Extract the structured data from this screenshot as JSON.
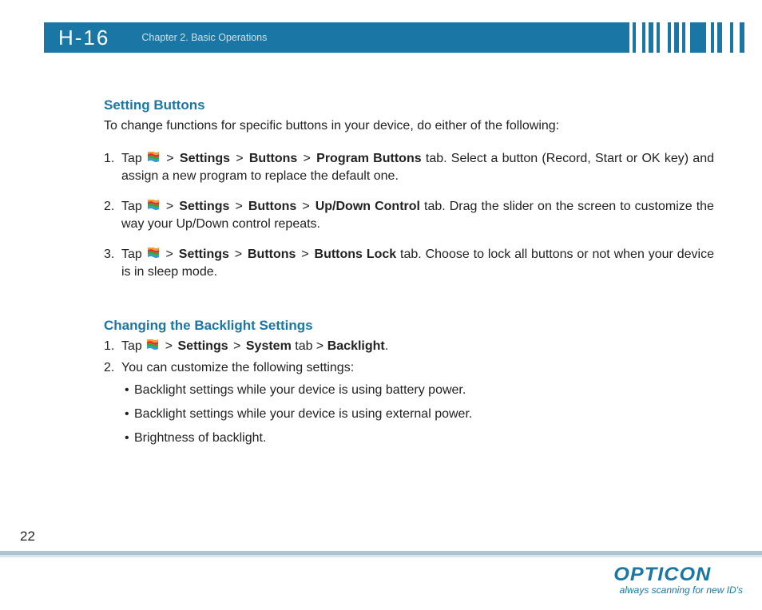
{
  "header": {
    "model": "H-16",
    "chapter": "Chapter 2. Basic Operations"
  },
  "sections": {
    "s1": {
      "heading": "Setting Buttons",
      "intro": "To change functions for specific buttons in your device, do either of the following:",
      "items": [
        {
          "num": "1.",
          "pre": "Tap ",
          "path1": "Settings",
          "path2": "Buttons",
          "path3": "Program Buttons",
          "post": " tab. Select a button (Record, Start or OK key) and assign a new program to replace the default one."
        },
        {
          "num": "2.",
          "pre": "Tap ",
          "path1": "Settings",
          "path2": "Buttons",
          "path3": "Up/Down Control",
          "post": " tab. Drag the slider on the screen to customize the way your Up/Down control repeats."
        },
        {
          "num": "3.",
          "pre": "Tap ",
          "path1": "Settings",
          "path2": "Buttons",
          "path3": "Buttons Lock",
          "post": " tab. Choose to lock all buttons or not when your device is in sleep mode."
        }
      ]
    },
    "s2": {
      "heading": "Changing the Backlight Settings",
      "items": [
        {
          "num": "1.",
          "pre": "Tap ",
          "path1": "Settings",
          "path2": "System",
          "tabword": " tab > ",
          "path3": "Backlight",
          "post": "."
        },
        {
          "num": "2.",
          "text": "You can customize the following settings:"
        }
      ],
      "bullets": [
        "Backlight settings while your device is using battery power.",
        "Backlight settings while your device is using external power.",
        "Brightness of backlight."
      ]
    }
  },
  "page_number": "22",
  "brand": {
    "name": "OPTICON",
    "tagline": "always scanning for new ID's"
  },
  "gt": ">"
}
